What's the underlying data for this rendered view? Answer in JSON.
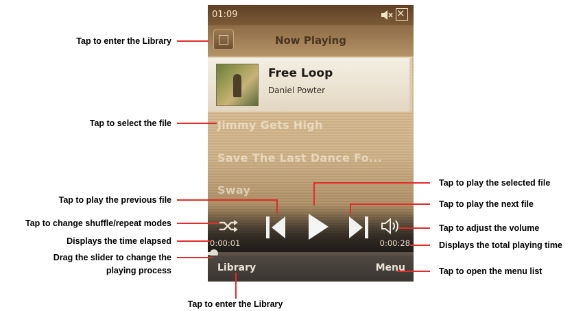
{
  "phone": {
    "status": {
      "time": "01:09"
    },
    "title": "Now Playing",
    "current_track": {
      "title": "Free Loop",
      "artist": "Daniel Powter"
    },
    "playlist": [
      "Jimmy Gets High",
      "Save The Last Dance Fo...",
      "Sway"
    ],
    "controls": {
      "elapsed": "0:00:01",
      "total": "0:00:28",
      "progress": 0.03
    },
    "softkeys": {
      "left": "Library",
      "right": "Menu"
    }
  },
  "annotations": {
    "enter_library_top": "Tap to enter the Library",
    "select_file": "Tap to select the file",
    "play_previous": "Tap to play the previous file",
    "shuffle_repeat": "Tap to change shuffle/repeat modes",
    "time_elapsed": "Displays the time elapsed",
    "drag_slider_line1": "Drag the slider to change the",
    "drag_slider_line2": "playing process",
    "play_selected": "Tap to play the selected file",
    "play_next": "Tap to play the next file",
    "adjust_volume": "Tap to adjust the volume",
    "total_time": "Displays the total playing time",
    "menu_list": "Tap to open the menu list",
    "enter_library_bottom": "Tap to enter the Library"
  },
  "colors": {
    "callout_line": "#e32b2b"
  }
}
